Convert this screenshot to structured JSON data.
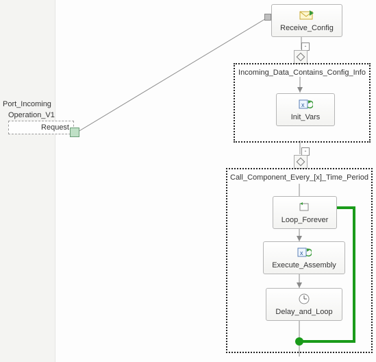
{
  "port": {
    "title": "Port_Incoming",
    "operation": "Operation_V1",
    "request_label": "Request"
  },
  "shapes": {
    "receive_config": "Receive_Config",
    "init_vars": "Init_Vars",
    "loop_forever": "Loop_Forever",
    "execute_assembly": "Execute_Assembly",
    "delay_and_loop": "Delay_and_Loop"
  },
  "groups": {
    "incoming": "Incoming_Data_Contains_Config_Info",
    "call_component": "Call_Component_Every_[x]_Time_Period"
  },
  "icons": {
    "receive": "envelope-in-icon",
    "vars": "variables-icon",
    "loop": "loop-icon",
    "exec": "assembly-icon",
    "delay": "clock-icon",
    "decision": "decision-icon"
  },
  "collapse_glyph": "-"
}
